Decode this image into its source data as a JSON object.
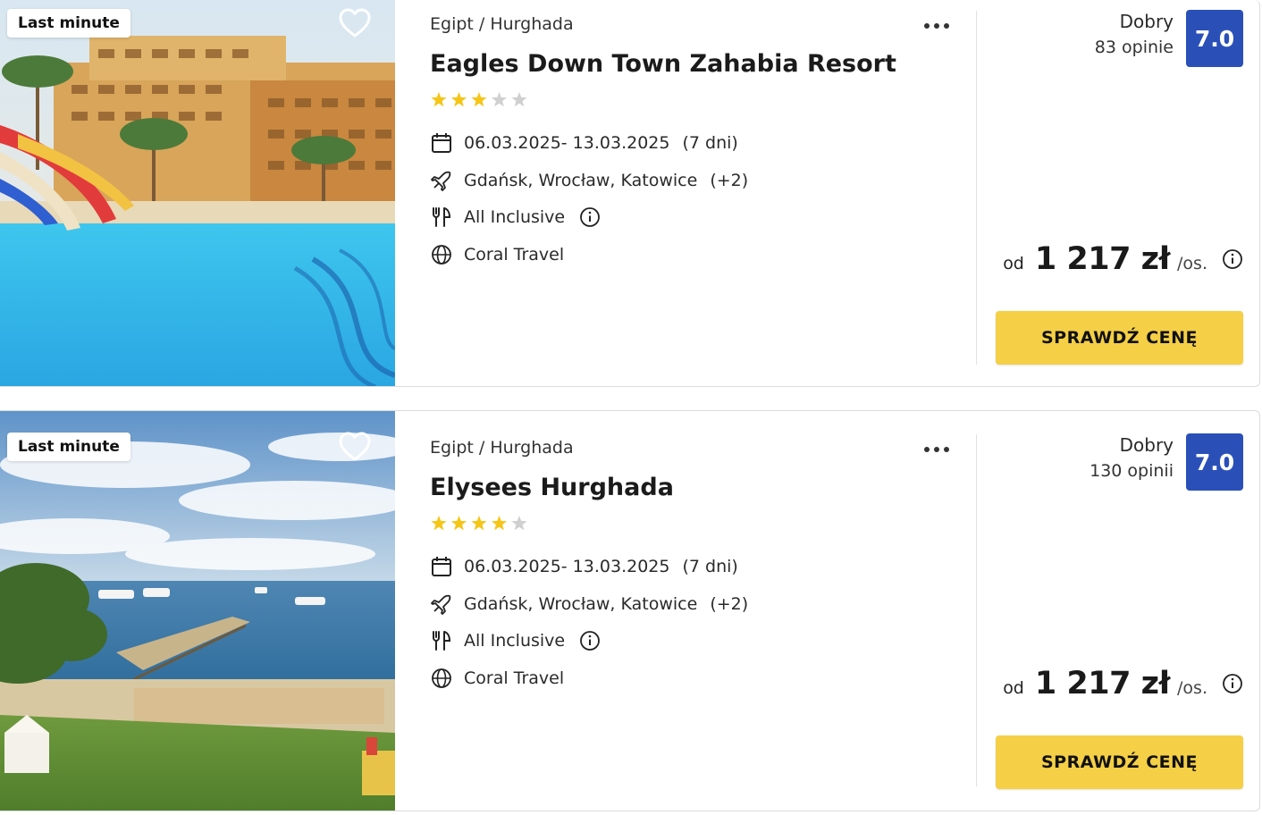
{
  "colors": {
    "accent": "#f5cf46",
    "score_bg": "#2a50b8",
    "star_filled": "#f5c518",
    "star_empty": "#d0d0d0"
  },
  "offers": [
    {
      "badge": "Last minute",
      "breadcrumb": "Egipt / Hurghada",
      "title": "Eagles Down Town Zahabia Resort",
      "stars": 3,
      "max_stars": 5,
      "dates": "06.03.2025- 13.03.2025",
      "duration": "(7 dni)",
      "departure": "Gdańsk, Wrocław, Katowice",
      "departure_more": "(+2)",
      "board": "All Inclusive",
      "operator": "Coral Travel",
      "rating_label": "Dobry",
      "reviews": "83 opinie",
      "score": "7.0",
      "price_prefix": "od",
      "price": "1 217 zł",
      "price_suffix": "/os.",
      "cta": "SPRAWDŹ CENĘ"
    },
    {
      "badge": "Last minute",
      "breadcrumb": "Egipt / Hurghada",
      "title": "Elysees Hurghada",
      "stars": 4,
      "max_stars": 5,
      "dates": "06.03.2025- 13.03.2025",
      "duration": "(7 dni)",
      "departure": "Gdańsk, Wrocław, Katowice",
      "departure_more": "(+2)",
      "board": "All Inclusive",
      "operator": "Coral Travel",
      "rating_label": "Dobry",
      "reviews": "130 opinii",
      "score": "7.0",
      "price_prefix": "od",
      "price": "1 217 zł",
      "price_suffix": "/os.",
      "cta": "SPRAWDŹ CENĘ"
    }
  ]
}
